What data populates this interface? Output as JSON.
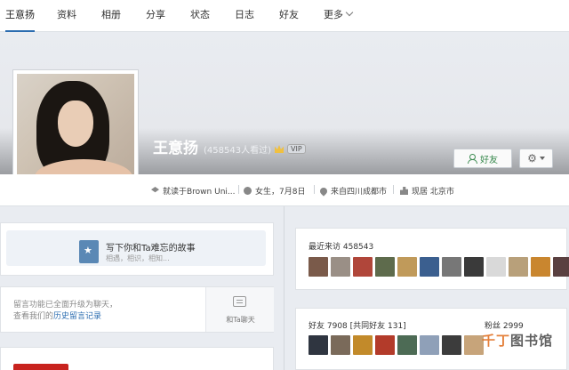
{
  "nav": {
    "items": [
      "王意扬",
      "资料",
      "相册",
      "分享",
      "状态",
      "日志",
      "好友",
      "更多"
    ],
    "active_index": 0
  },
  "profile": {
    "name": "王意扬",
    "views": "(458543人看过)",
    "vip": "VIP",
    "friend_button": "好友",
    "info": {
      "school": "就读于Brown Uni...",
      "gender_birthday": "女生，7月8日",
      "hometown": "来自四川成都市",
      "current_city": "现居 北京市"
    }
  },
  "story": {
    "title": "写下你和Ta难忘的故事",
    "subtitle": "相遇，相识，相知..."
  },
  "message": {
    "line1": "留言功能已全面升级为聊天，",
    "line2_prefix": "查看我们的",
    "line2_link": "历史留言记录",
    "chat_label": "和Ta聊天"
  },
  "recent_visitors": {
    "label": "最近来访 458543",
    "thumb_colors": [
      "#7a5a4a",
      "#9a8f86",
      "#b0463a",
      "#5e6b4c",
      "#c09a5a",
      "#3b5f8f",
      "#777777",
      "#3a3a3a",
      "#d9d9d9",
      "#b8a07a",
      "#c9862f",
      "#5a4040"
    ]
  },
  "friends": {
    "label": "好友 7908 [共同好友 131]",
    "fans_label": "粉丝 2999",
    "thumb_colors": [
      "#2f3540",
      "#7a6a5a",
      "#c28a2a",
      "#b33b2a",
      "#4d6b55",
      "#8fa0b8",
      "#3c3c3c",
      "#c7a47a"
    ]
  },
  "watermark": {
    "part1": "千丁",
    "part2": "图书馆"
  }
}
